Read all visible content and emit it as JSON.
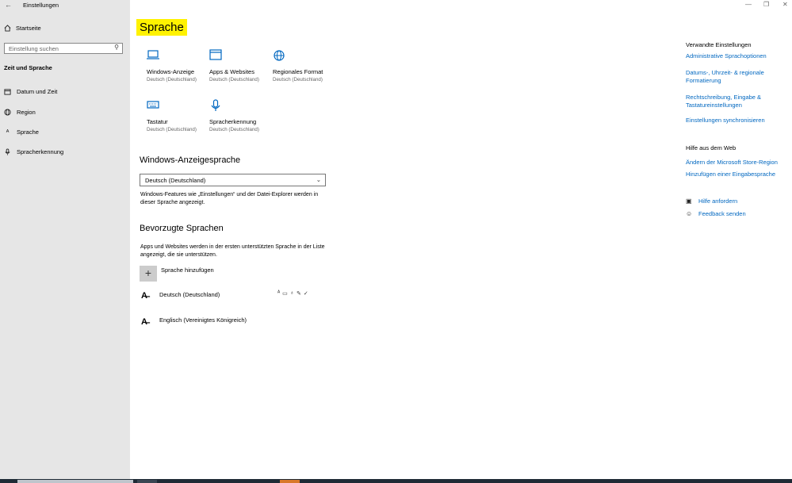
{
  "window": {
    "title": "Einstellungen",
    "back_icon": "←",
    "minimize": "—",
    "maximize": "❐",
    "close": "✕"
  },
  "sidebar": {
    "home": "Startseite",
    "search_placeholder": "Einstellung suchen",
    "section": "Zeit und Sprache",
    "items": [
      {
        "label": "Datum und Zeit",
        "icon": "calendar-icon"
      },
      {
        "label": "Region",
        "icon": "globe-icon"
      },
      {
        "label": "Sprache",
        "icon": "language-icon"
      },
      {
        "label": "Spracherkennung",
        "icon": "microphone-icon"
      }
    ]
  },
  "main": {
    "page_title": "Sprache",
    "tiles": [
      {
        "name": "Windows-Anzeige",
        "sub": "Deutsch (Deutschland)",
        "icon": "laptop-icon"
      },
      {
        "name": "Apps & Websites",
        "sub": "Deutsch (Deutschland)",
        "icon": "window-icon"
      },
      {
        "name": "Regionales Format",
        "sub": "Deutsch (Deutschland)",
        "icon": "globe-settings-icon"
      },
      {
        "name": "Tastatur",
        "sub": "Deutsch (Deutschland)",
        "icon": "keyboard-icon"
      },
      {
        "name": "Spracherkennung",
        "sub": "Deutsch (Deutschland)",
        "icon": "microphone-icon"
      }
    ],
    "display_language": {
      "heading": "Windows-Anzeigesprache",
      "selected": "Deutsch (Deutschland)",
      "description": "Windows-Features wie „Einstellungen“ und der Datei-Explorer werden in dieser Sprache angezeigt."
    },
    "preferred": {
      "heading": "Bevorzugte Sprachen",
      "description": "Apps und Websites werden in der ersten unterstützten Sprache in der Liste angezeigt, die sie unterstützen.",
      "add_label": "Sprache hinzufügen",
      "languages": [
        {
          "name": "Deutsch (Deutschland)"
        },
        {
          "name": "Englisch (Vereinigtes Königreich)"
        }
      ]
    }
  },
  "right": {
    "related_title": "Verwandte Einstellungen",
    "related_links": [
      "Administrative Sprachoptionen",
      "Datums-, Uhrzeit- & regionale Formatierung",
      "Rechtschreibung, Eingabe & Tastatureinstellungen",
      "Einstellungen synchronisieren"
    ],
    "web_title": "Hilfe aus dem Web",
    "web_links": [
      "Ändern der Microsoft Store-Region",
      "Hinzufügen einer Eingabesprache"
    ],
    "help": "Hilfe anfordern",
    "feedback": "Feedback senden"
  },
  "colors": {
    "accent": "#0067c0",
    "highlight": "#fff200",
    "sidebar_bg": "#e6e6e6"
  }
}
